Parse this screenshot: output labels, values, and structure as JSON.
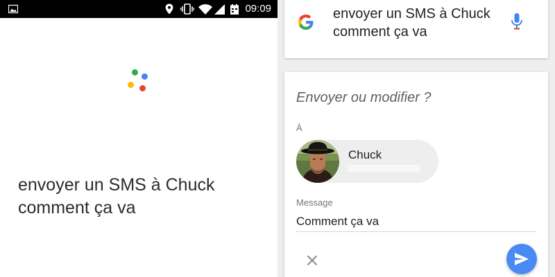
{
  "status_bar": {
    "time": "09:09",
    "icons": [
      "image-icon",
      "location-pin-icon",
      "vibrate-icon",
      "wifi-icon",
      "cell-signal-icon",
      "calendar-icon"
    ]
  },
  "left": {
    "spoken_query": "envoyer un SMS à Chuck comment ça va",
    "assistant_dot_colors": [
      "#4285F4",
      "#EA4335",
      "#FBBC05",
      "#34A853"
    ]
  },
  "right": {
    "search": {
      "query": "envoyer un SMS à Chuck comment ça va",
      "icon_left": "google-g-icon",
      "icon_right": "mic-icon"
    },
    "sms_card": {
      "prompt": "Envoyer ou modifier ?",
      "to_label": "À",
      "recipient": {
        "name": "Chuck"
      },
      "message_label": "Message",
      "message_value": "Comment ça va",
      "cancel_icon": "close-icon",
      "send_icon": "send-icon"
    }
  },
  "colors": {
    "google_blue": "#4285F4",
    "google_red": "#EA4335",
    "google_yellow": "#FBBC05",
    "google_green": "#34A853",
    "send_button": "#4A8AF4",
    "status_bar_bg": "#000000"
  }
}
